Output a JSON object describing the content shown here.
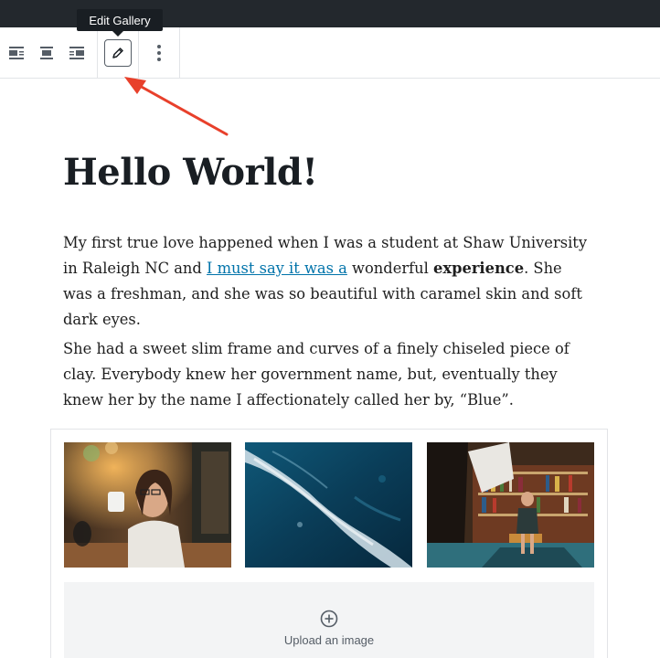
{
  "toolbar": {
    "buttons": [
      {
        "name": "align-left",
        "icon": "align-left-icon"
      },
      {
        "name": "align-center",
        "icon": "align-center-icon"
      },
      {
        "name": "align-right",
        "icon": "align-right-icon"
      },
      {
        "name": "edit-gallery",
        "icon": "pencil-icon"
      },
      {
        "name": "more-options",
        "icon": "vertical-ellipsis-icon"
      }
    ],
    "tooltip": "Edit Gallery"
  },
  "post": {
    "title": "Hello World!",
    "paragraph1": {
      "before_link": "My first true love happened when I was a student at Shaw University in Raleigh NC and ",
      "link": "I must say it was a",
      "middle": " wonderful ",
      "bold": "experience",
      "after": ". She was a freshman, and she was so beautiful with caramel skin and soft dark eyes."
    },
    "paragraph2": "She had a sweet slim frame and curves of a finely chiseled piece of clay. Everybody knew her government name, but, eventually they knew her by the name I affectionately called her by, “Blue”."
  },
  "gallery": {
    "images": [
      {
        "name": "woman-drinking-coffee"
      },
      {
        "name": "ocean-wave-aerial"
      },
      {
        "name": "woman-in-library"
      }
    ],
    "upload_label": "Upload an image"
  },
  "colors": {
    "topbar": "#23282d",
    "link": "#0073aa",
    "arrow": "#e8402b",
    "tooltip_bg": "#191e23"
  }
}
